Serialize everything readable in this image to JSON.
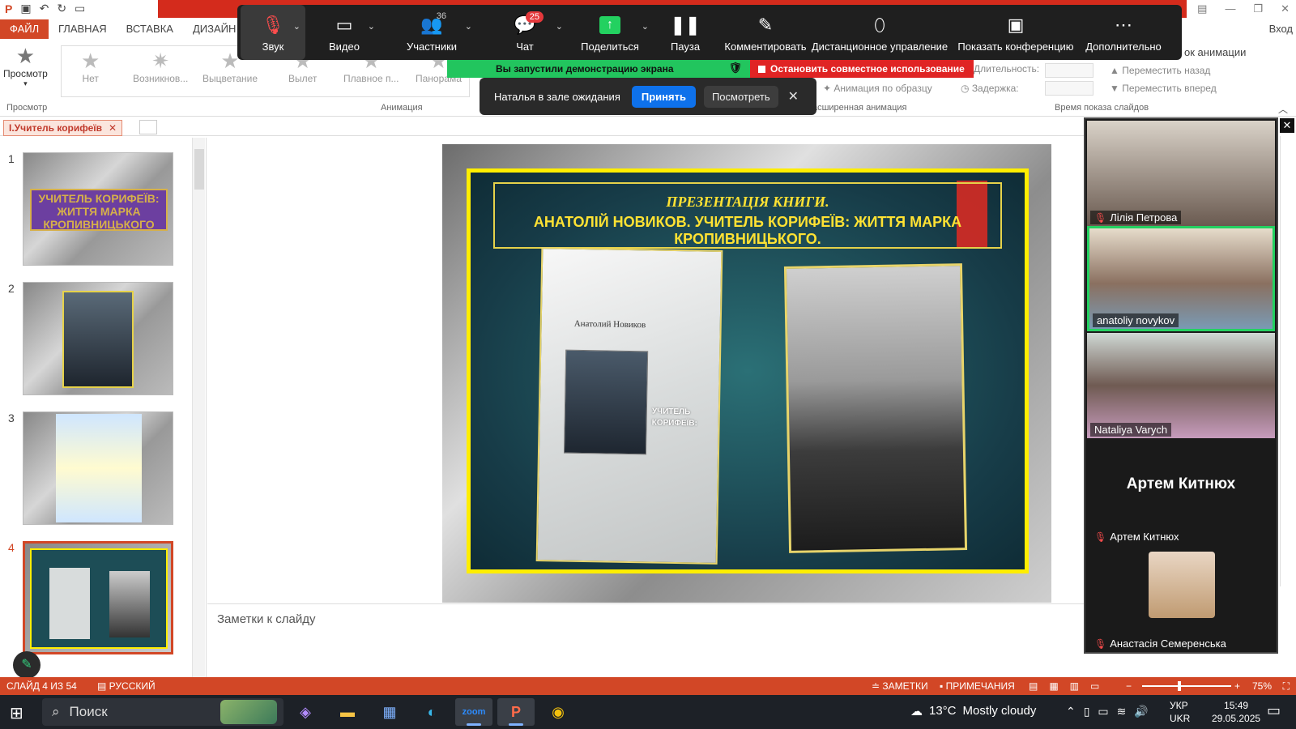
{
  "ppt": {
    "tabs": [
      "ФАЙЛ",
      "ГЛАВНАЯ",
      "ВСТАВКА",
      "ДИЗАЙН"
    ],
    "login": "Вход",
    "preview_label": "Просмотр",
    "preview_group": "Просмотр",
    "animations": [
      "Нет",
      "Возникнов...",
      "Выцветание",
      "Вылет",
      "Плавное п...",
      "Панорама"
    ],
    "animation_group": "Анимация",
    "advanced_anim_group": "Расширенная анимация",
    "anim_painter": "Анимация по образцу",
    "duration_label": "Длительность:",
    "delay_label": "Задержка:",
    "move_back": "Переместить назад",
    "move_forward": "Переместить вперед",
    "timing_group": "Время показа слайдов",
    "anim_order_label": "ок анимации",
    "doc_tab": "І.Учитель корифеїв",
    "notes_placeholder": "Заметки к слайду"
  },
  "zoom_toolbar": {
    "audio": "Звук",
    "video": "Видео",
    "participants": "Участники",
    "participants_count": "36",
    "chat": "Чат",
    "chat_badge": "25",
    "share": "Поделиться",
    "pause": "Пауза",
    "annotate": "Комментировать",
    "remote_control": "Дистанционное управление",
    "show_conference": "Показать конференцию",
    "more": "Дополнительно"
  },
  "share_banner": {
    "text": "Вы запустили демонстрацию экрана",
    "stop": "Остановить совместное использование"
  },
  "waiting_room": {
    "text": "Наталья в зале ожидания",
    "accept": "Принять",
    "view": "Посмотреть"
  },
  "thumbnails": [
    {
      "num": "1",
      "caption": "УЧИТЕЛЬ КОРИФЕЇВ: ЖИТТЯ МАРКА КРОПИВНИЦЬКОГО"
    },
    {
      "num": "2"
    },
    {
      "num": "3"
    },
    {
      "num": "4"
    }
  ],
  "slide": {
    "title_line1": "ПРЕЗЕНТАЦІЯ КНИГИ.",
    "title_line2": "АНАТОЛІЙ НОВИКОВ. УЧИТЕЛЬ КОРИФЕЇВ: ЖИТТЯ МАРКА КРОПИВНИЦЬКОГО.",
    "book_author": "Анатолий Новиков",
    "book_title": "УЧИТЕЛЬ КОРИФЕЇВ:"
  },
  "participants": [
    {
      "name": "Лілія Петрова",
      "muted": true
    },
    {
      "name": "anatoliy novykov",
      "muted": false
    },
    {
      "name": "Nataliya Varych",
      "muted": false
    },
    {
      "name": "Артем Китнюх",
      "muted": true,
      "initials_display": "Артем Китнюх"
    },
    {
      "name": "Анастасія Семеренська",
      "muted": true
    }
  ],
  "statusbar": {
    "slide_info": "СЛАЙД 4 ИЗ 54",
    "language": "РУССКИЙ",
    "notes": "ЗАМЕТКИ",
    "comments": "ПРИМЕЧАНИЯ",
    "zoom": "75%"
  },
  "taskbar": {
    "search": "Поиск",
    "weather_temp": "13°C",
    "weather_text": "Mostly cloudy",
    "lang_top": "УКР",
    "lang_bottom": "UKR",
    "time": "15:49",
    "date": "29.05.2025"
  },
  "colors": {
    "ppt_accent": "#d24726",
    "zoom_green": "#22c55e",
    "zoom_red": "#e02424",
    "zoom_blue": "#0e71eb",
    "slide_yellow": "#ffee00"
  }
}
